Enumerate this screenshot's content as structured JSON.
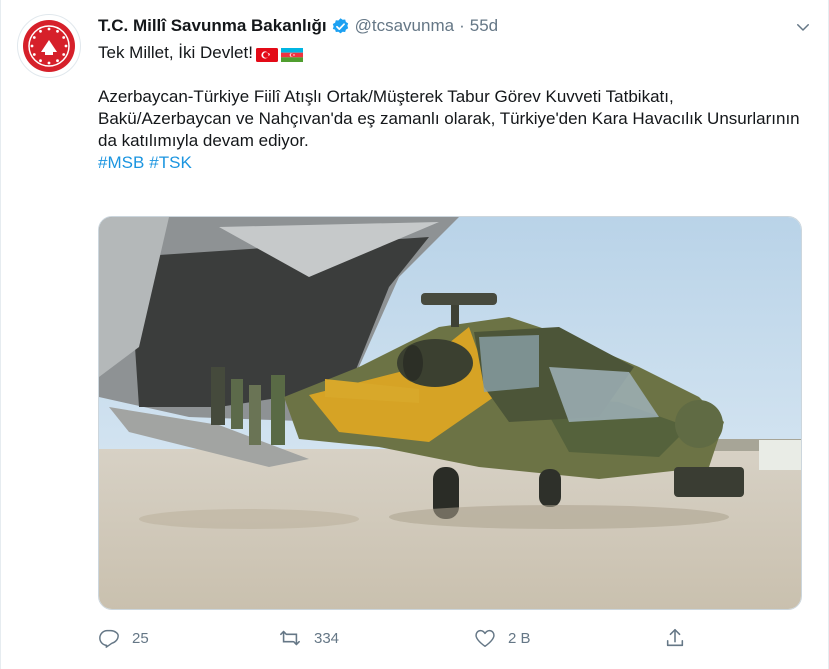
{
  "tweet": {
    "display_name": "T.C. Millî Savunma Bakanlığı",
    "handle": "@tcsavunma",
    "separator": "·",
    "time": "55d",
    "subline": "Tek Millet, İki Devlet!",
    "flags": [
      "turkey-flag",
      "azerbaijan-flag"
    ],
    "body": "Azerbaycan-Türkiye Fiilî Atışlı Ortak/Müşterek Tabur Görev Kuvveti Tatbikatı, Bakü/Azerbaycan ve Nahçıvan'da eş zamanlı olarak, Türkiye'den Kara Havacılık Unsurlarının da katılımıyla devam ediyor.",
    "hashtags": [
      "#MSB",
      "#TSK"
    ]
  },
  "actions": {
    "reply_count": "25",
    "retweet_count": "334",
    "like_count": "2 B"
  },
  "colors": {
    "link": "#1b95e0",
    "muted": "#657786",
    "verified": "#1da1f2",
    "avatar_red": "#d6202a"
  }
}
